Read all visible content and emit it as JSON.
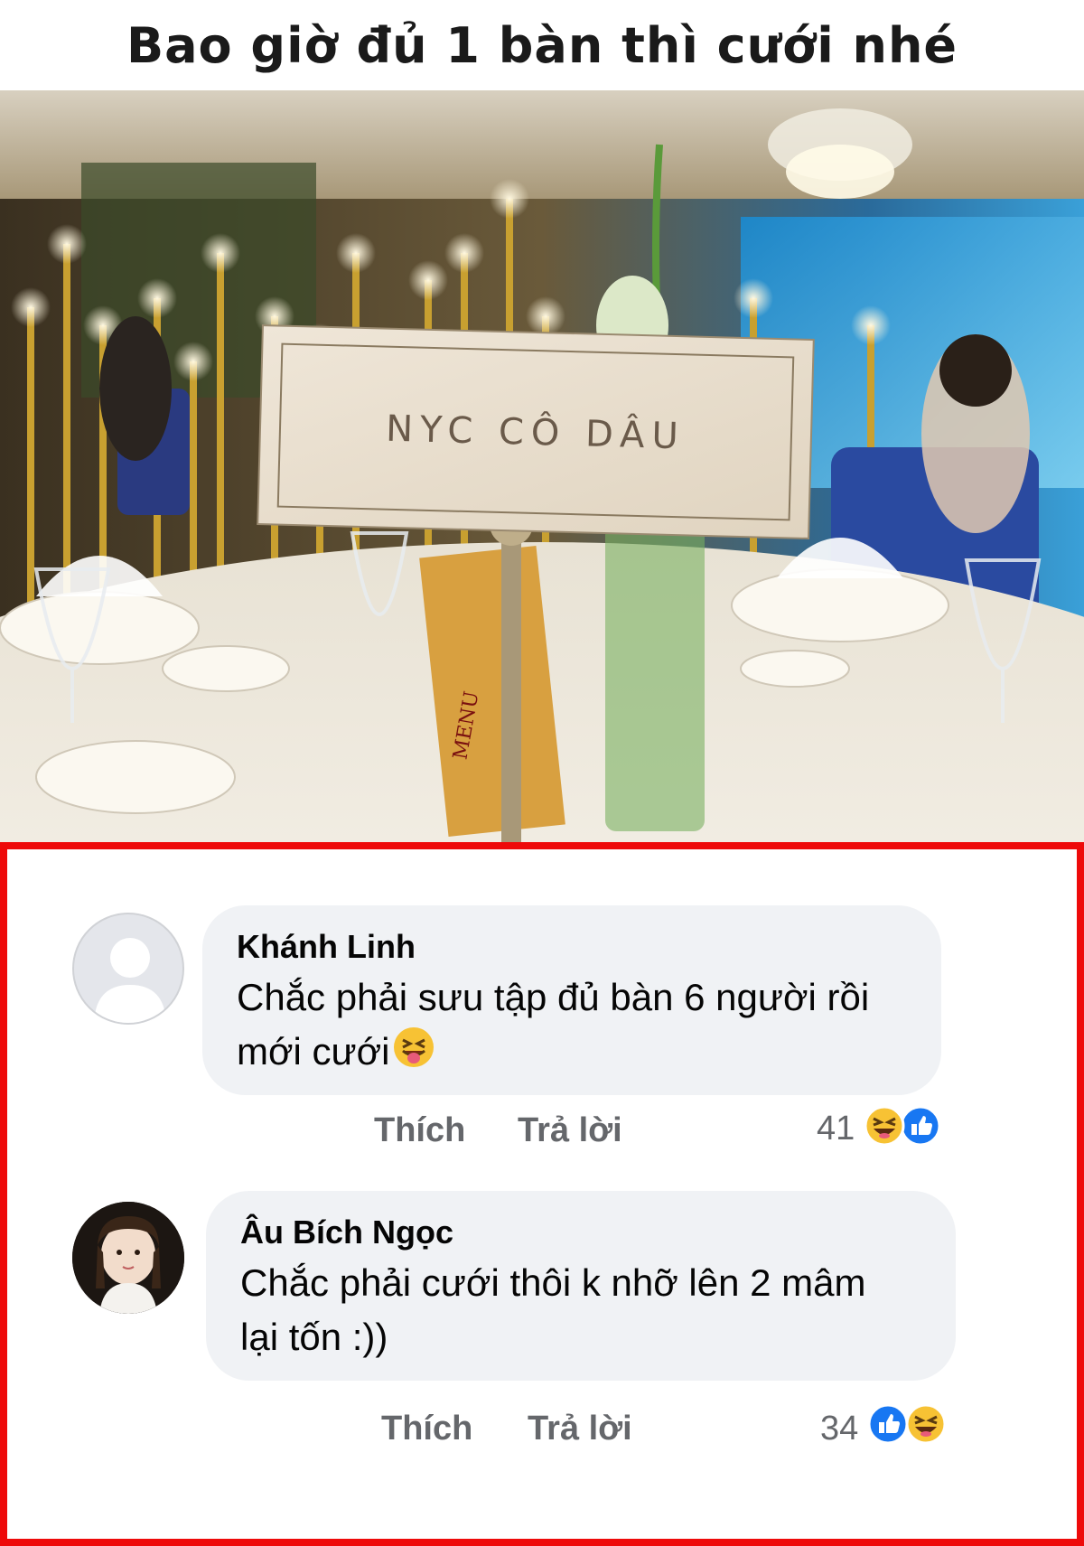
{
  "meme": {
    "title": "Bao giờ đủ 1 bàn thì cưới nhé",
    "sign_text": "NYC CÔ DÂU",
    "menu_text": "MENU"
  },
  "comments": [
    {
      "author": "Khánh Linh",
      "text_line1": "Chắc phải sưu tập đủ bàn 6 người rồi",
      "text_line2": "mới cưới",
      "emoji": "squinting-tongue-emoji",
      "like_label": "Thích",
      "reply_label": "Trả lời",
      "reaction_count": "41",
      "reactions": [
        "haha-reaction-icon",
        "like-reaction-icon"
      ]
    },
    {
      "author": "Âu Bích Ngọc",
      "text_line1": "Chắc phải cưới thôi k nhỡ lên 2 mâm",
      "text_line2": "lại tốn :))",
      "like_label": "Thích",
      "reply_label": "Trả lời",
      "reaction_count": "34",
      "reactions": [
        "like-reaction-icon",
        "haha-reaction-icon"
      ]
    }
  ],
  "colors": {
    "border": "#ee0a0a",
    "bubble": "#f0f2f5",
    "action_text": "#65676b",
    "like_blue": "#1877f2",
    "haha_yellow": "#f7c234"
  }
}
